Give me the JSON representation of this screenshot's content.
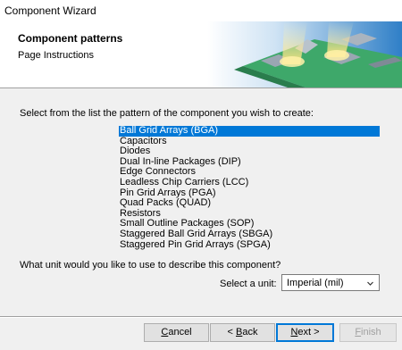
{
  "window": {
    "title": "Component Wizard"
  },
  "header": {
    "title": "Component patterns",
    "subtitle": "Page Instructions"
  },
  "content": {
    "instruction": "Select from the list the pattern of the component you wish to create:",
    "patterns": [
      "Ball Grid Arrays (BGA)",
      "Capacitors",
      "Diodes",
      "Dual In-line Packages (DIP)",
      "Edge Connectors",
      "Leadless Chip Carriers (LCC)",
      "Pin Grid Arrays (PGA)",
      "Quad Packs (QUAD)",
      "Resistors",
      "Small Outline Packages (SOP)",
      "Staggered Ball Grid Arrays (SBGA)",
      "Staggered Pin Grid Arrays (SPGA)"
    ],
    "selected_pattern": "Ball Grid Arrays (BGA)",
    "unit_question": "What unit would you like to use to describe this component?",
    "unit_label": "Select a unit:",
    "unit_value": "Imperial (mil)"
  },
  "buttons": {
    "cancel": {
      "prefix": "",
      "underline": "C",
      "suffix": "ancel"
    },
    "back": {
      "prefix": "< ",
      "underline": "B",
      "suffix": "ack"
    },
    "next": {
      "prefix": "",
      "underline": "N",
      "suffix": "ext >"
    },
    "finish": {
      "prefix": "",
      "underline": "F",
      "suffix": "inish"
    }
  },
  "colors": {
    "selection": "#0078d7",
    "default_button_border": "#0078d7"
  }
}
